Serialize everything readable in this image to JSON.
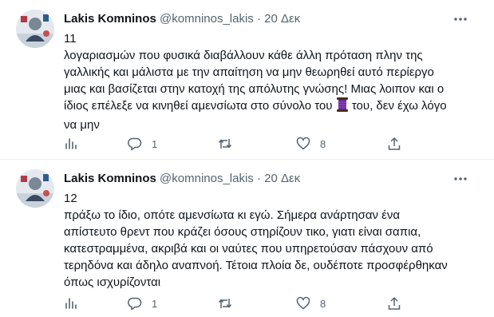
{
  "tweets": [
    {
      "name": "Lakis Komninos",
      "handle": "@komninos_lakis",
      "separator": "·",
      "time": "20 Δεκ",
      "lines": [
        "11",
        "λογαριασμών  που φυσικά διαβάλλουν κάθε άλλη πρόταση πλην της",
        "γαλλικής και μάλιστα με την απαίτηση να μην θεωρηθεί αυτό περίεργο",
        "μιας και βασίζεται στην κατοχή της απόλυτης γνώσης! Μιας λοιπον και ο",
        "ίδιος επέλεξε να κινηθεί αμενσίωτα στο σύνολο του",
        "του, δεν έχω λόγο",
        "να μην"
      ],
      "emoji": "spool-of-thread",
      "reply_count": "1",
      "retweet_count": "",
      "like_count": "8"
    },
    {
      "name": "Lakis Komninos",
      "handle": "@komninos_lakis",
      "separator": "·",
      "time": "20 Δεκ",
      "lines": [
        "12",
        "πράξω το ίδιο, οπότε αμενσίωτα κι εγώ. Σήμερα ανάρτησαν ένα",
        "απίστευτο θρεντ που κράζει όσους στηρίζουν τικο, γιατι είναι σαπια,",
        "κατεστραμμένα, ακριβά και οι ναύτες που υπηρετούσαν πάσχουν από",
        "τερηδόνα και άδηλο αναπνοή. Τέτοια πλοία δε, ουδέποτε προσφέρθηκαν",
        "όπως ισχυρίζονται"
      ],
      "reply_count": "1",
      "retweet_count": "",
      "like_count": "8"
    }
  ],
  "colors": {
    "text": "#0f1419",
    "secondary": "#536471",
    "divider": "#eff3f4",
    "emoji_purple": "#6b2fa0"
  },
  "icons": [
    "avatar",
    "more-icon",
    "analytics-icon",
    "reply-icon",
    "retweet-icon",
    "like-icon",
    "share-icon"
  ]
}
